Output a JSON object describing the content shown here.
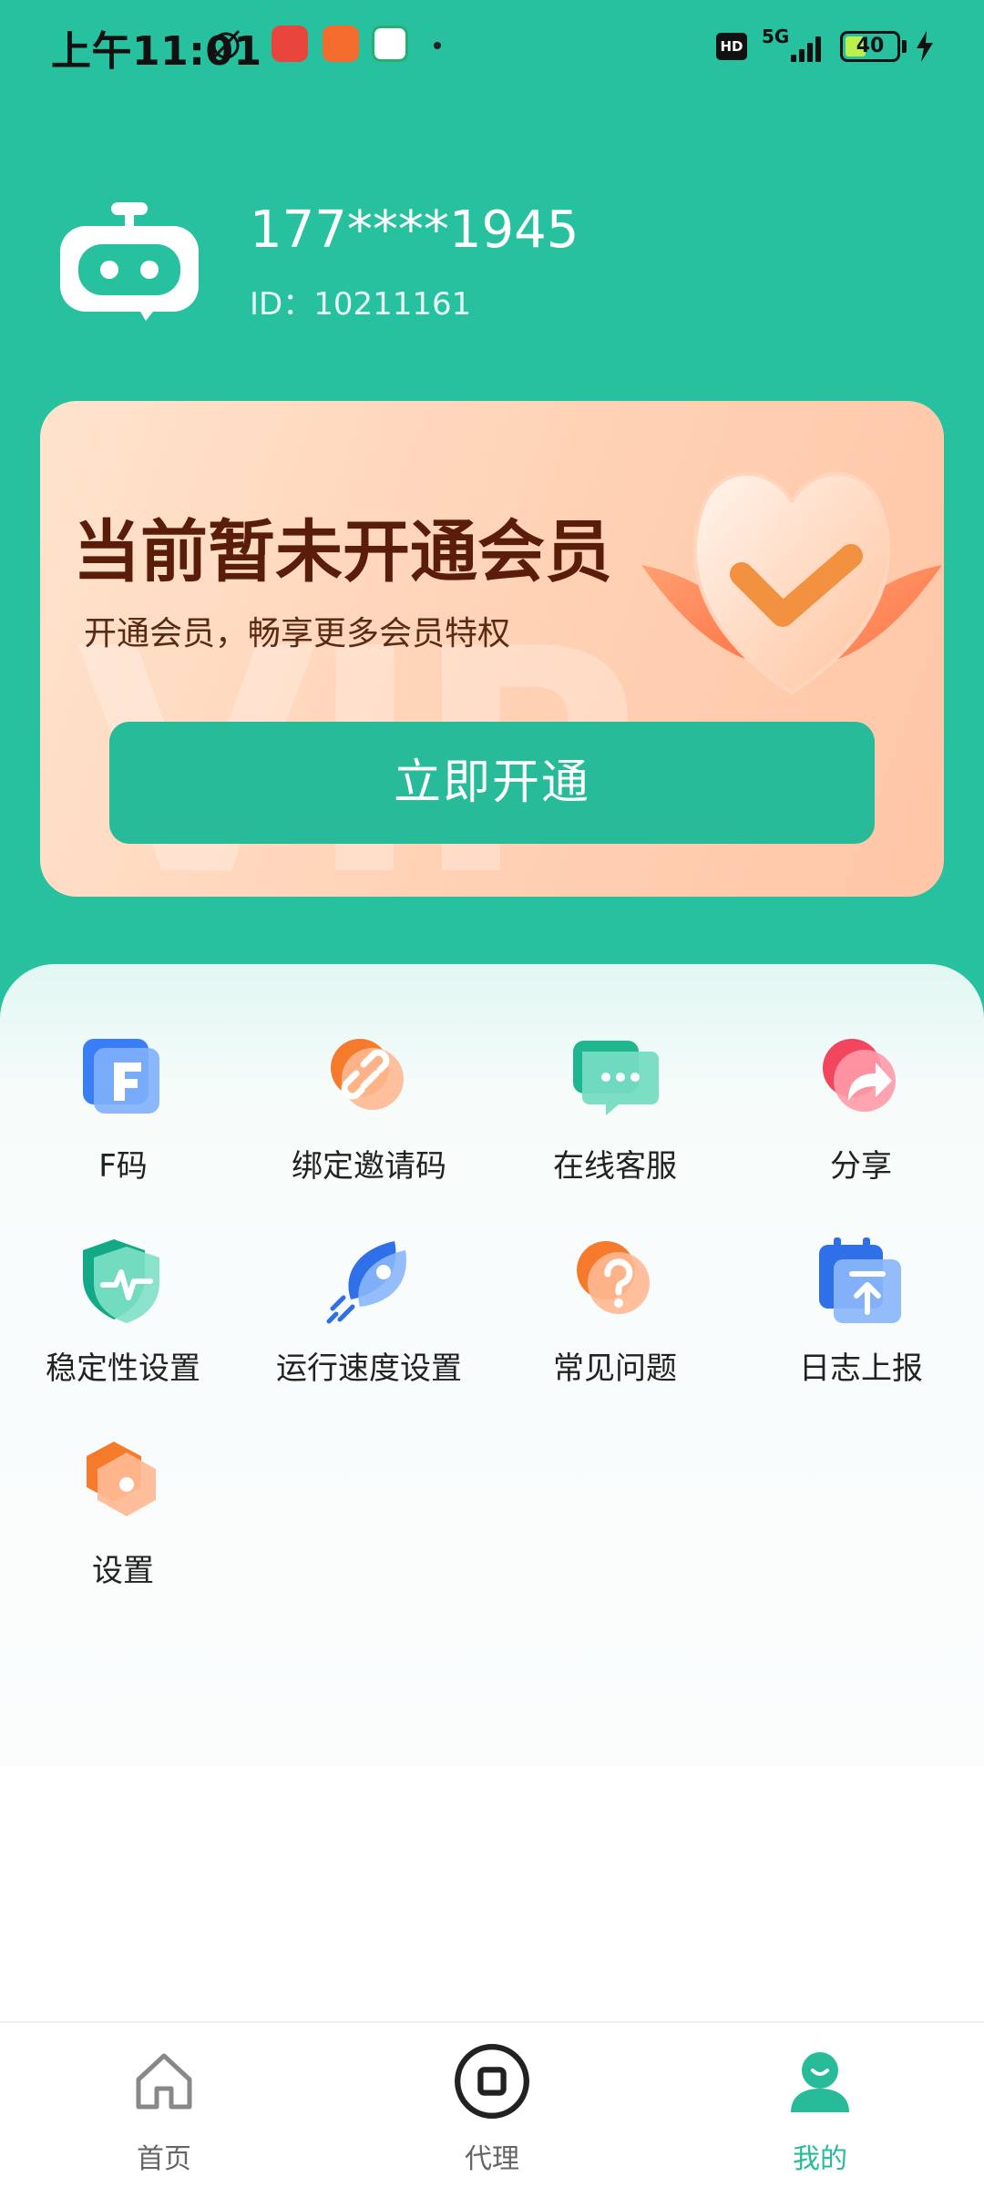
{
  "status_bar": {
    "time": "上午11:01",
    "network": "5G",
    "hd": "HD",
    "battery": "40",
    "battery_level": 0.4
  },
  "profile": {
    "phone": "177****1945",
    "id_text": "ID：10211161",
    "avatar_icon": "robot-face-icon"
  },
  "vip_card": {
    "title": "当前暂未开通会员",
    "subtitle": "开通会员，畅享更多会员特权",
    "button_label": "立即开通"
  },
  "menu": [
    {
      "label": "F码",
      "icon": "f-code-icon"
    },
    {
      "label": "绑定邀请码",
      "icon": "link-icon"
    },
    {
      "label": "在线客服",
      "icon": "chat-icon"
    },
    {
      "label": "分享",
      "icon": "share-icon"
    },
    {
      "label": "稳定性设置",
      "icon": "shield-pulse-icon"
    },
    {
      "label": "运行速度设置",
      "icon": "rocket-icon"
    },
    {
      "label": "常见问题",
      "icon": "question-icon"
    },
    {
      "label": "日志上报",
      "icon": "calendar-upload-icon"
    },
    {
      "label": "设置",
      "icon": "settings-icon"
    }
  ],
  "bottom_nav": [
    {
      "label": "首页",
      "icon": "home-icon",
      "active": false
    },
    {
      "label": "代理",
      "icon": "proxy-power-icon",
      "active": false
    },
    {
      "label": "我的",
      "icon": "profile-icon",
      "active": true
    }
  ],
  "colors": {
    "brand": "#27c1a0",
    "button": "#27bb9a",
    "vip_title": "#5a1d0a"
  }
}
